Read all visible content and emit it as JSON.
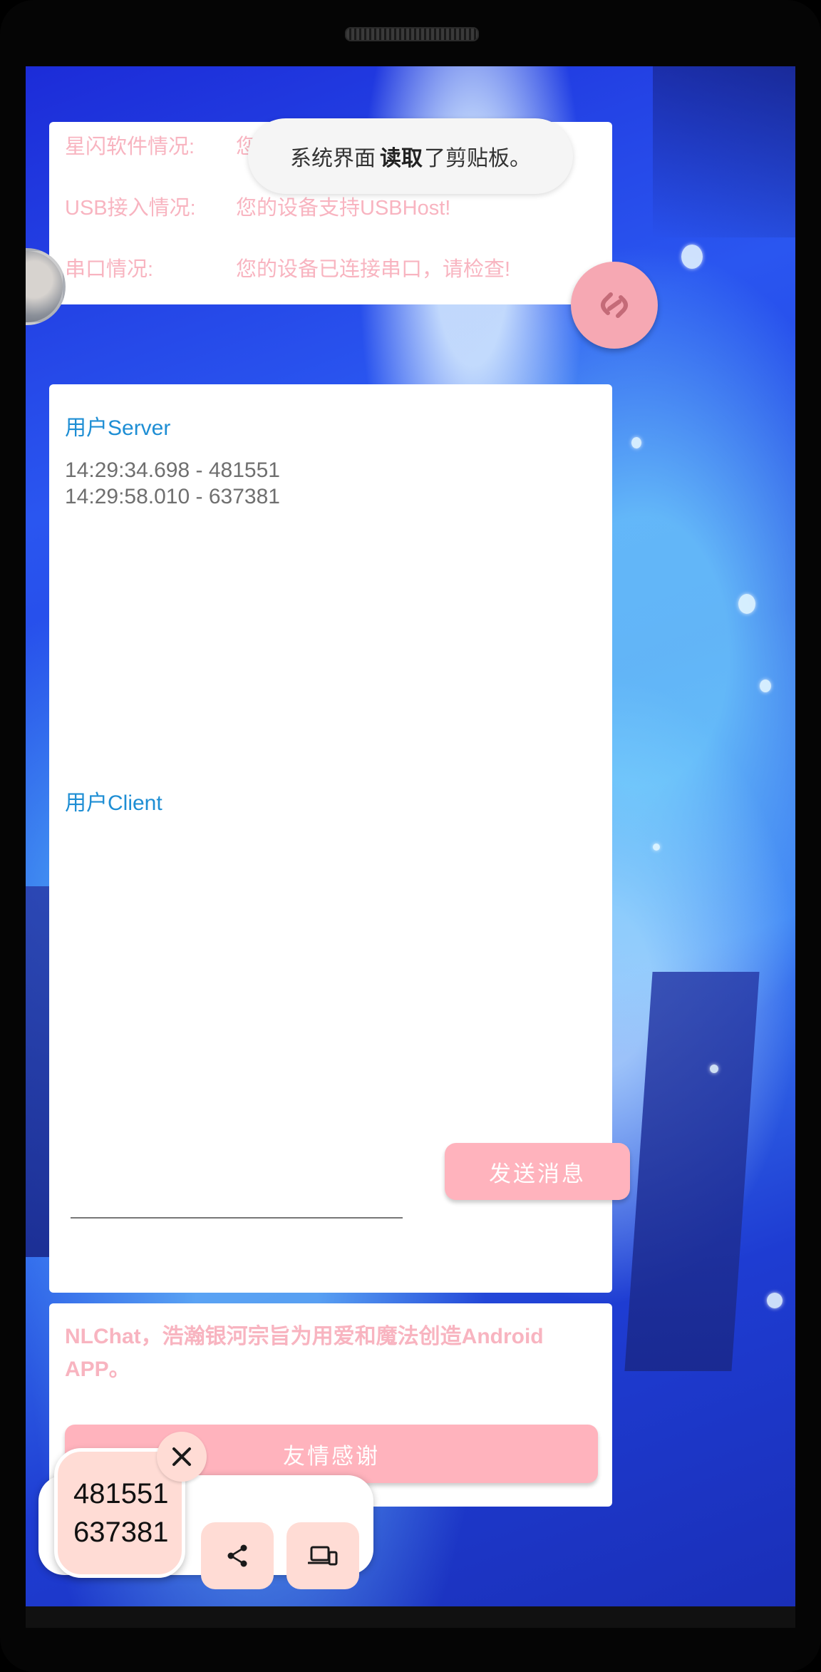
{
  "status": {
    "rows": [
      {
        "key": "星闪软件情况:",
        "value": "您成"
      },
      {
        "key": "USB接入情况:",
        "value": "您的设备支持USBHost!"
      },
      {
        "key": "串口情况:",
        "value": "您的设备已连接串口，请检查!"
      }
    ]
  },
  "toast": {
    "prefix": "系统界面",
    "bold": "读取",
    "suffix": "了剪贴板。"
  },
  "chat": {
    "server_title": "用户Server",
    "server_log": [
      "14:29:34.698 - 481551",
      "14:29:58.010 - 637381"
    ],
    "client_title": "用户Client",
    "input_value": "",
    "send_label": "发送消息"
  },
  "about": {
    "text": "NLChat，浩瀚银河宗旨为用爱和魔法创造Android APP。",
    "thanks_label": "友情感谢"
  },
  "clipboard": {
    "lines": [
      "481551",
      "637381"
    ]
  },
  "icons": {
    "fab": "link-icon",
    "close": "close-icon",
    "share": "share-icon",
    "devices": "devices-icon"
  },
  "colors": {
    "accent_pink": "#ffb3bd",
    "status_text": "#f8b4c0",
    "title_blue": "#1e8ed4",
    "clip_bg": "#ffdcd5"
  }
}
